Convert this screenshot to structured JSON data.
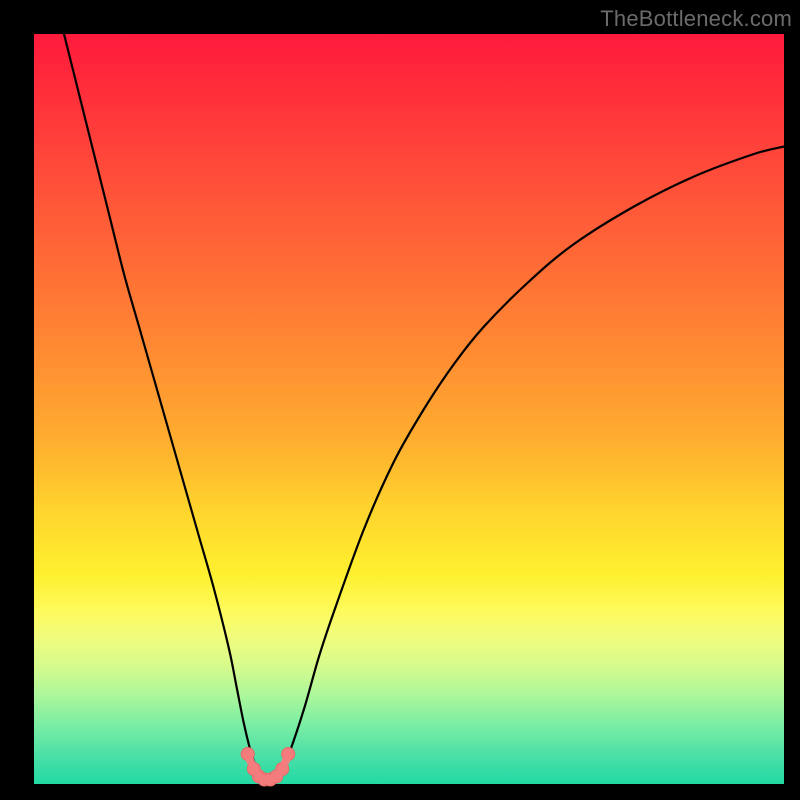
{
  "watermark": "TheBottleneck.com",
  "colors": {
    "frame": "#000000",
    "curve": "#000000",
    "marker_fill": "#f47c7c",
    "marker_stroke": "#e66a6a"
  },
  "chart_data": {
    "type": "line",
    "title": "",
    "xlabel": "",
    "ylabel": "",
    "xlim": [
      0,
      100
    ],
    "ylim": [
      0,
      100
    ],
    "grid": false,
    "legend": false,
    "series": [
      {
        "name": "bottleneck-curve",
        "x": [
          4,
          6,
          8,
          10,
          12,
          14,
          16,
          18,
          20,
          22,
          24,
          26,
          27,
          28,
          29,
          30,
          31,
          32,
          33,
          34,
          36,
          38,
          40,
          44,
          48,
          52,
          56,
          60,
          66,
          72,
          80,
          88,
          96,
          100
        ],
        "values": [
          100,
          92,
          84,
          76,
          68,
          61,
          54,
          47,
          40,
          33,
          26,
          18,
          13,
          8,
          4,
          1.5,
          0.6,
          0.5,
          1.5,
          4,
          10,
          17,
          23,
          34,
          43,
          50,
          56,
          61,
          67,
          72,
          77,
          81,
          84,
          85
        ]
      }
    ],
    "markers": {
      "name": "bottom-cluster",
      "x": [
        28.5,
        29.3,
        30.0,
        30.7,
        31.5,
        32.3,
        33.1,
        33.9
      ],
      "values": [
        4.0,
        2.0,
        1.0,
        0.6,
        0.6,
        1.0,
        2.0,
        4.0
      ]
    }
  }
}
